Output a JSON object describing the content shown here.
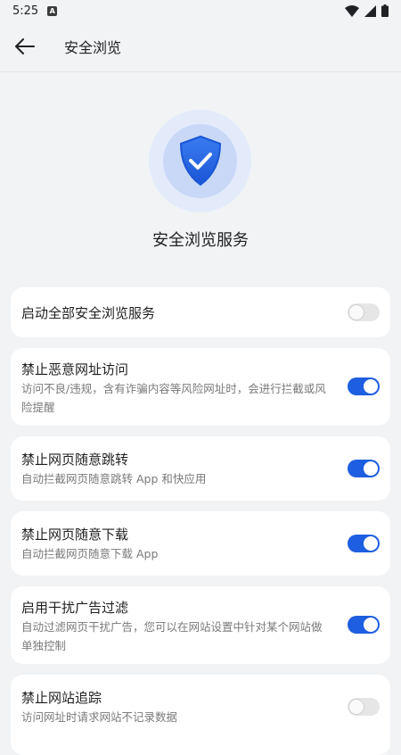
{
  "status_bar": {
    "time": "5:25",
    "notif_icon": "A"
  },
  "app_bar": {
    "title": "安全浏览"
  },
  "hero": {
    "title": "安全浏览服务"
  },
  "settings": [
    {
      "title": "启动全部安全浏览服务",
      "desc": "",
      "enabled": false
    },
    {
      "title": "禁止恶意网址访问",
      "desc": "访问不良/违规，含有诈骗内容等风险网址时，会进行拦截或风险提醒",
      "enabled": true
    },
    {
      "title": "禁止网页随意跳转",
      "desc": "自动拦截网页随意跳转 App 和快应用",
      "enabled": true
    },
    {
      "title": "禁止网页随意下载",
      "desc": "自动拦截网页随意下载 App",
      "enabled": true
    },
    {
      "title": "启用干扰广告过滤",
      "desc": "自动过滤网页干扰广告，您可以在网站设置中针对某个网站做单独控制",
      "enabled": true
    },
    {
      "title": "禁止网站追踪",
      "desc": "访问网址时请求网站不记录数据",
      "enabled": false
    }
  ],
  "colors": {
    "accent": "#1e5ee0",
    "background": "#f1f3f5"
  }
}
